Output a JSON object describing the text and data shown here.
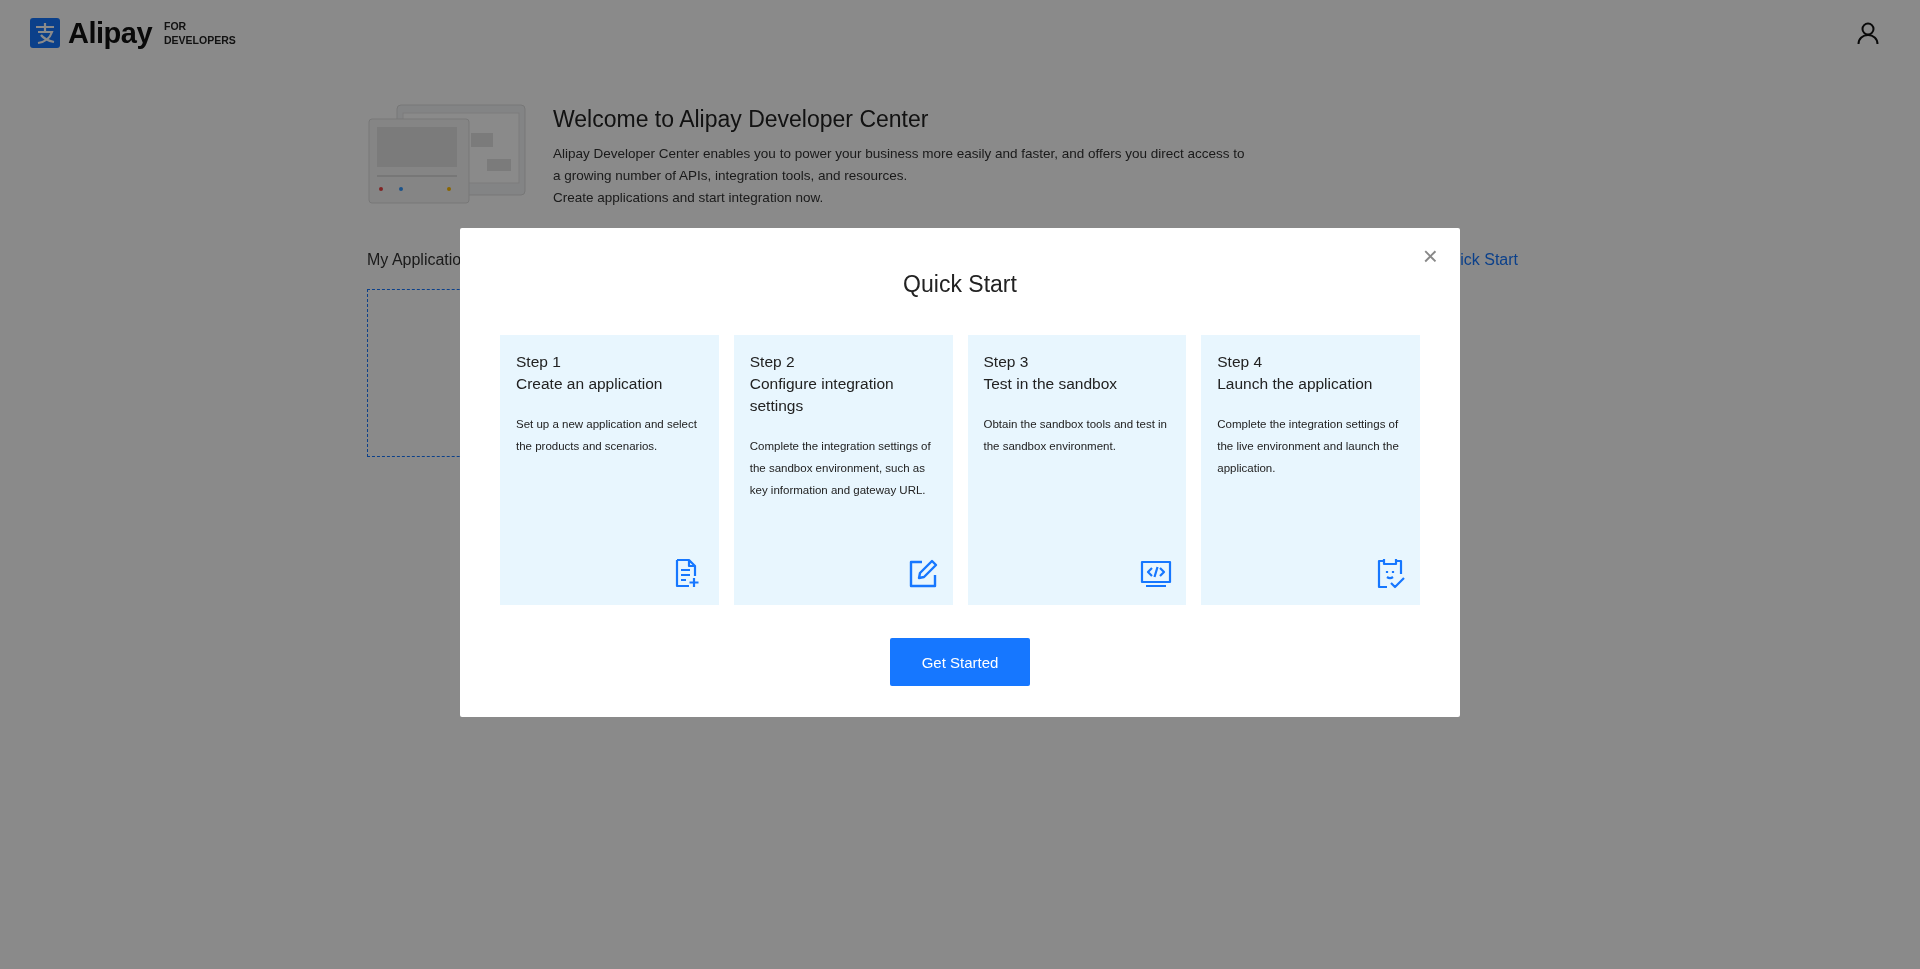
{
  "header": {
    "logo_text": "Alipay",
    "logo_subtitle": [
      "FOR",
      "DEVELOPERS"
    ]
  },
  "welcome": {
    "title": "Welcome to Alipay Developer Center",
    "lines": [
      "Alipay Developer Center enables you to power your business more easily and faster, and offers you direct access to a growing number of APIs, integration tools, and resources.",
      "Create applications and start integration now."
    ]
  },
  "my_applications": {
    "label": "My Applicatio",
    "link": "ick Start"
  },
  "modal": {
    "title": "Quick Start",
    "close": "×",
    "button": "Get Started",
    "steps": [
      {
        "step": "Step 1",
        "title": "Create an application",
        "description": "Set up a new application and select the products and scenarios.",
        "kind": "document"
      },
      {
        "step": "Step 2",
        "title": "Configure integration settings",
        "description": "Complete the integration settings of the sandbox environment, such as key information and gateway URL.",
        "kind": "edit"
      },
      {
        "step": "Step 3",
        "title": "Test in the sandbox",
        "description": "Obtain the sandbox tools and test in the sandbox environment.",
        "kind": "code"
      },
      {
        "step": "Step 4",
        "title": "Launch the application",
        "description": "Complete the integration settings of the live environment and launch the application.",
        "kind": "launch"
      }
    ]
  }
}
